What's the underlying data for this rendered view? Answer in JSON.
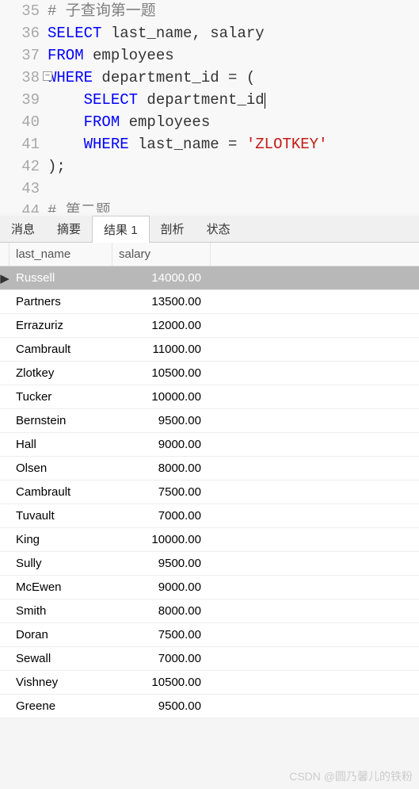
{
  "code": {
    "lines": [
      {
        "n": "35",
        "comment": "# 子查询第一题"
      },
      {
        "n": "36",
        "tokens": [
          [
            "kw",
            "SELECT"
          ],
          [
            "ident",
            " last_name, salary"
          ]
        ]
      },
      {
        "n": "37",
        "tokens": [
          [
            "kw",
            "FROM"
          ],
          [
            "ident",
            " employees"
          ]
        ]
      },
      {
        "n": "38",
        "fold": true,
        "tokens": [
          [
            "kw",
            "WHERE"
          ],
          [
            "ident",
            " department_id = ("
          ]
        ]
      },
      {
        "n": "39",
        "indent": "    ",
        "tokens": [
          [
            "kw",
            "SELECT"
          ],
          [
            "ident",
            " department_id"
          ]
        ],
        "cursor": true
      },
      {
        "n": "40",
        "indent": "    ",
        "tokens": [
          [
            "kw",
            "FROM"
          ],
          [
            "ident",
            " employees"
          ]
        ]
      },
      {
        "n": "41",
        "indent": "    ",
        "tokens": [
          [
            "kw",
            "WHERE"
          ],
          [
            "ident",
            " last_name = "
          ],
          [
            "str",
            "'ZLOTKEY'"
          ]
        ]
      },
      {
        "n": "42",
        "tokens": [
          [
            "ident",
            ");"
          ]
        ]
      },
      {
        "n": "43",
        "tokens": []
      }
    ],
    "partial_line_number": "44",
    "partial_comment": "# 第二题"
  },
  "tabs": {
    "items": [
      {
        "label": "消息",
        "active": false
      },
      {
        "label": "摘要",
        "active": false
      },
      {
        "label": "结果 1",
        "active": true
      },
      {
        "label": "剖析",
        "active": false
      },
      {
        "label": "状态",
        "active": false
      }
    ]
  },
  "results": {
    "columns": [
      "last_name",
      "salary"
    ],
    "rows": [
      {
        "last_name": "Russell",
        "salary": "14000.00",
        "selected": true,
        "indicator": "▶"
      },
      {
        "last_name": "Partners",
        "salary": "13500.00"
      },
      {
        "last_name": "Errazuriz",
        "salary": "12000.00"
      },
      {
        "last_name": "Cambrault",
        "salary": "11000.00"
      },
      {
        "last_name": "Zlotkey",
        "salary": "10500.00"
      },
      {
        "last_name": "Tucker",
        "salary": "10000.00"
      },
      {
        "last_name": "Bernstein",
        "salary": "9500.00"
      },
      {
        "last_name": "Hall",
        "salary": "9000.00"
      },
      {
        "last_name": "Olsen",
        "salary": "8000.00"
      },
      {
        "last_name": "Cambrault",
        "salary": "7500.00"
      },
      {
        "last_name": "Tuvault",
        "salary": "7000.00"
      },
      {
        "last_name": "King",
        "salary": "10000.00"
      },
      {
        "last_name": "Sully",
        "salary": "9500.00"
      },
      {
        "last_name": "McEwen",
        "salary": "9000.00"
      },
      {
        "last_name": "Smith",
        "salary": "8000.00"
      },
      {
        "last_name": "Doran",
        "salary": "7500.00"
      },
      {
        "last_name": "Sewall",
        "salary": "7000.00"
      },
      {
        "last_name": "Vishney",
        "salary": "10500.00"
      },
      {
        "last_name": "Greene",
        "salary": "9500.00"
      }
    ]
  },
  "watermark": "CSDN @圆乃馨儿的铁粉"
}
